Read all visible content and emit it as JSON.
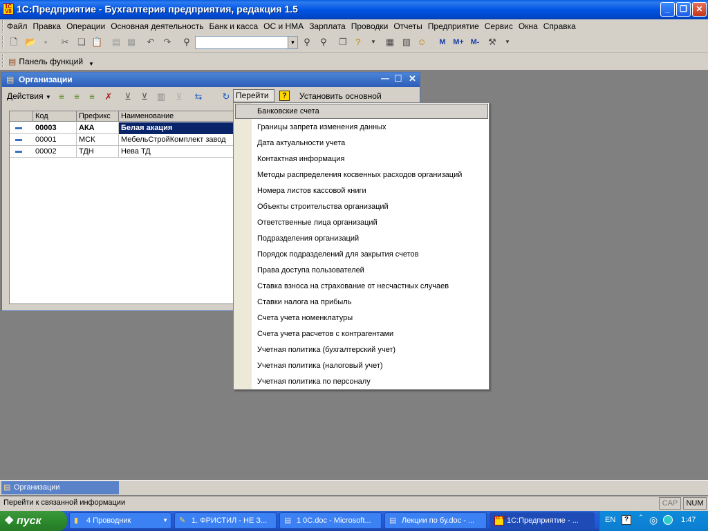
{
  "window": {
    "title": "1С:Предприятие - Бухгалтерия предприятия, редакция 1.5",
    "icon_text": "1C"
  },
  "menubar": [
    "Файл",
    "Правка",
    "Операции",
    "Основная деятельность",
    "Банк и касса",
    "ОС и НМА",
    "Зарплата",
    "Проводки",
    "Отчеты",
    "Предприятие",
    "Сервис",
    "Окна",
    "Справка"
  ],
  "toolbar": {
    "search_value": "",
    "buttons_right": [
      "М",
      "М+",
      "М-"
    ]
  },
  "function_panel": {
    "label": "Панель функций"
  },
  "org_window": {
    "title": "Организации",
    "actions_label": "Действия",
    "goto_label": "Перейти",
    "set_main_label": "Установить основной",
    "help_label": "?",
    "columns": [
      "Код",
      "Префикс",
      "Наименование"
    ],
    "rows": [
      {
        "code": "00003",
        "prefix": "АКА",
        "name": "Белая акация",
        "bold": true,
        "selected": true
      },
      {
        "code": "00001",
        "prefix": "МСК",
        "name": "МебельСтройКомплект завод"
      },
      {
        "code": "00002",
        "prefix": "ТДН",
        "name": "Нева ТД"
      }
    ]
  },
  "goto_menu": [
    "Банковские счета",
    "Границы запрета изменения данных",
    "Дата актуальности учета",
    "Контактная информация",
    "Методы распределения косвенных расходов организаций",
    "Номера листов кассовой книги",
    "Объекты строительства организаций",
    "Ответственные лица организаций",
    "Подразделения организаций",
    "Порядок подразделений для закрытия счетов",
    "Права доступа пользователей",
    "Ставка взноса на страхование от несчастных случаев",
    "Ставки налога на прибыль",
    "Счета учета номенклатуры",
    "Счета учета расчетов с контрагентами",
    "Учетная политика (бухгалтерский учет)",
    "Учетная политика (налоговый учет)",
    "Учетная политика по персоналу"
  ],
  "window_tabs": [
    "Организации"
  ],
  "status": {
    "text": "Перейти к связанной информации",
    "cap": "CAP",
    "num": "NUM"
  },
  "taskbar": {
    "start": "пуск",
    "tasks": [
      "4 Проводник",
      "1. ФРИСТИЛ - НЕ З...",
      "1 0С.doc - Microsoft...",
      "Лекции по бу.doc - ...",
      "1С:Предприятие - ..."
    ],
    "lang": "EN",
    "clock": "1:47"
  }
}
